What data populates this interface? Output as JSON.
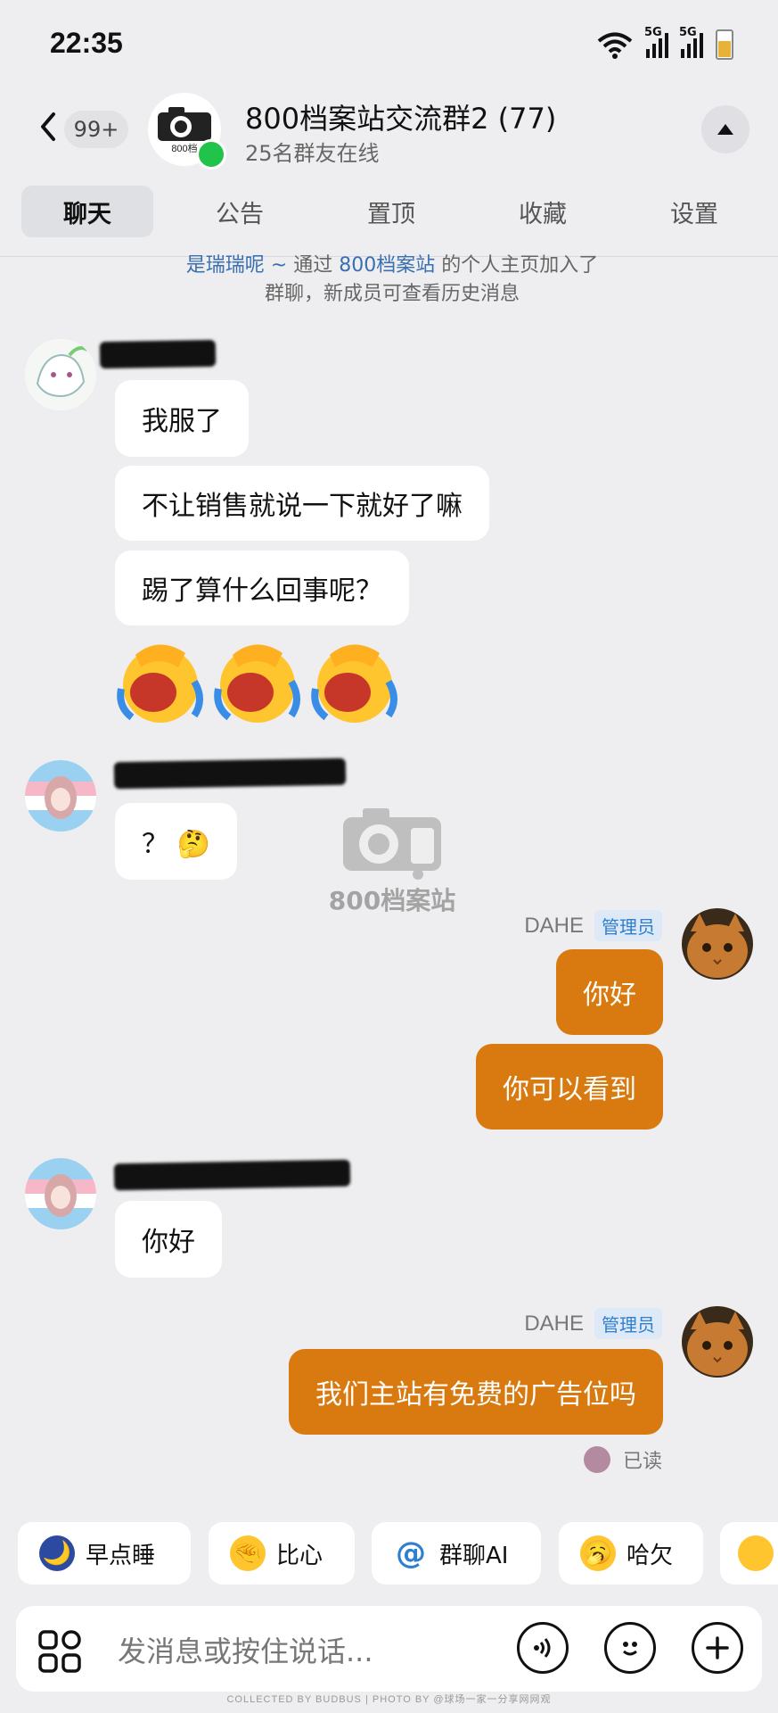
{
  "status_bar": {
    "time": "22:35",
    "signal_1_label": "5G",
    "signal_2_label": "5G",
    "wifi_sub": "6"
  },
  "header": {
    "unread_badge": "99+",
    "group_title": "800档案站交流群2 (77)",
    "online_status": "25名群友在线",
    "avatar_text": "800档"
  },
  "tabs": [
    {
      "label": "聊天",
      "active": true
    },
    {
      "label": "公告",
      "active": false
    },
    {
      "label": "置顶",
      "active": false
    },
    {
      "label": "收藏",
      "active": false
    },
    {
      "label": "设置",
      "active": false
    }
  ],
  "system_message": {
    "name": "是瑞瑞呢 ~",
    "via": " 通过 ",
    "source": "800档案站",
    "rest": " 的个人主页加入了",
    "line2": "群聊，新成员可查看历史消息"
  },
  "messages": {
    "m1": "我服了",
    "m2": "不让销售就说一下就好了嘛",
    "m3": "踢了算什么回事呢？",
    "m4": "？ 🤔",
    "sender_dahe": "DAHE",
    "admin_tag": "管理员",
    "m5": "你好",
    "m6": "你可以看到",
    "m7": "你好",
    "m8": "我们主站有免费的广告位吗",
    "read_status": "已读"
  },
  "watermark": {
    "text": "800档案站"
  },
  "quick_replies": [
    {
      "label": "早点睡",
      "icon": "🌙"
    },
    {
      "label": "比心",
      "icon": "🤏"
    },
    {
      "label": "群聊AI",
      "icon": "@"
    },
    {
      "label": "哈欠",
      "icon": "🥱"
    }
  ],
  "input": {
    "placeholder": "发消息或按住说话..."
  },
  "footer": {
    "credit": "COLLECTED BY BUDBUS | PHOTO BY @球场一家一分享网网观"
  },
  "colors": {
    "my_bubble": "#d87a0f",
    "online": "#22c34a",
    "admin_tag": "#2e7fd0"
  }
}
